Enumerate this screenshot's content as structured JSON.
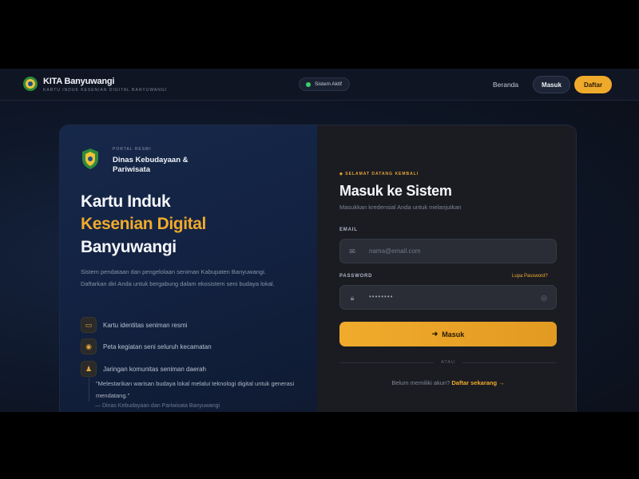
{
  "brand": {
    "name": "KITA Banyuwangi",
    "subtitle": "KARTU INDUK KESENIAN DIGITAL BANYUWANGI"
  },
  "status": {
    "label": "Sistem Aktif",
    "color": "#3bd16f"
  },
  "nav": {
    "home": "Beranda",
    "login": "Masuk",
    "register": "Daftar"
  },
  "colors": {
    "accent": "#f0aa2b",
    "panel_dark": "#1b1c22",
    "panel_blue": "#132242"
  },
  "org": {
    "eyebrow": "PORTAL RESMI",
    "name": "Dinas Kebudayaan & Pariwisata"
  },
  "hero": {
    "line1": "Kartu Induk",
    "line2": "Kesenian Digital",
    "line3": "Banyuwangi",
    "description": "Sistem pendataan dan pengelolaan seniman Kabupaten Banyuwangi. Daftarkan diri Anda untuk bergabung dalam ekosistem seni budaya lokal."
  },
  "features": [
    {
      "icon": "id-card-icon",
      "label": "Kartu identitas seniman resmi"
    },
    {
      "icon": "map-pin-icon",
      "label": "Peta kegiatan seni seluruh kecamatan"
    },
    {
      "icon": "users-icon",
      "label": "Jaringan komunitas seniman daerah"
    }
  ],
  "quote": {
    "text": "\"Melestarikan warisan budaya lokal melalui teknologi digital untuk generasi mendatang.\"",
    "author": "— Dinas Kebudayaan dan Pariwisata Banyuwangi"
  },
  "form": {
    "eyebrow": "◆ SELAMAT DATANG KEMBALI",
    "title": "Masuk ke Sistem",
    "subtitle": "Masukkan kredensial Anda untuk melanjutkan",
    "email_label": "EMAIL",
    "email_placeholder": "nama@email.com",
    "password_label": "PASSWORD",
    "forgot": "Lupa Password?",
    "password_value": "••••••••",
    "submit": "Masuk",
    "divider": "ATAU",
    "signup_prompt": "Belum memiliki akun?",
    "signup_link": "Daftar sekarang →"
  }
}
